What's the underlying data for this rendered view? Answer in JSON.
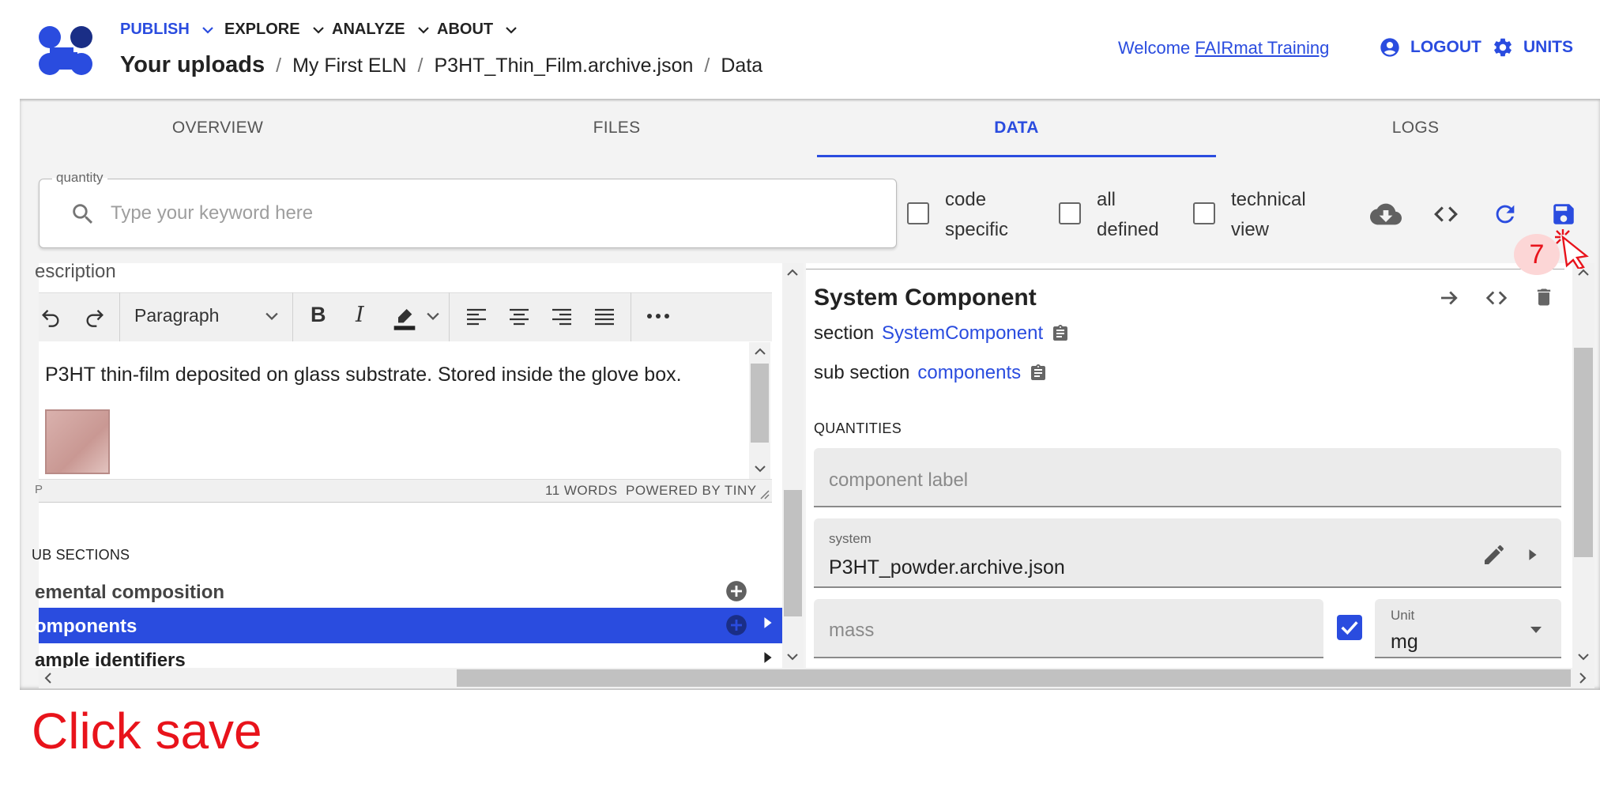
{
  "header": {
    "menu": [
      {
        "label": "PUBLISH",
        "active": true
      },
      {
        "label": "EXPLORE",
        "active": false
      },
      {
        "label": "ANALYZE",
        "active": false
      },
      {
        "label": "ABOUT",
        "active": false
      }
    ],
    "breadcrumb": [
      "Your uploads",
      "My First ELN",
      "P3HT_Thin_Film.archive.json",
      "Data"
    ],
    "welcome_prefix": "Welcome",
    "user_name": "FAIRmat Training",
    "logout_label": "LOGOUT",
    "units_label": "UNITS"
  },
  "tabs": [
    {
      "label": "OVERVIEW",
      "active": false
    },
    {
      "label": "FILES",
      "active": false
    },
    {
      "label": "DATA",
      "active": true
    },
    {
      "label": "LOGS",
      "active": false
    }
  ],
  "search": {
    "legend": "quantity",
    "placeholder": "Type your keyword here",
    "value": ""
  },
  "filters": [
    {
      "line1": "code",
      "line2": "specific",
      "checked": false
    },
    {
      "line1": "all",
      "line2": "defined",
      "checked": false
    },
    {
      "line1": "technical",
      "line2": "view",
      "checked": false
    }
  ],
  "toolbar_icons": [
    "cloud-download-icon",
    "code-icon",
    "reload-icon",
    "save-icon"
  ],
  "left_panel": {
    "description_heading": "escription",
    "editor": {
      "block_format": "Paragraph",
      "text": "P3HT thin-film deposited on glass substrate. Stored inside the glove box.",
      "status_left": "P",
      "status_words": "11 WORDS",
      "status_powered": "POWERED BY TINY"
    },
    "subsections_heading": "UB SECTIONS",
    "subsections": [
      {
        "label": "emental composition",
        "active": false
      },
      {
        "label": "omponents",
        "active": true
      },
      {
        "label": "ample identifiers",
        "active": false
      }
    ]
  },
  "right_panel": {
    "title": "System Component",
    "section_label": "section",
    "section_link": "SystemComponent",
    "subsection_label": "sub section",
    "subsection_link": "components",
    "quantities_heading": "QUANTITIES",
    "component_label_placeholder": "component label",
    "system_small_label": "system",
    "system_value": "P3HT_powder.archive.json",
    "mass_placeholder": "mass",
    "mass_checked": true,
    "unit_small_label": "Unit",
    "unit_value": "mg"
  },
  "overlay": {
    "step_number": "7",
    "caption": "Click save"
  },
  "colors": {
    "accent": "#2a4cdf",
    "caption_red": "#e8131b"
  }
}
